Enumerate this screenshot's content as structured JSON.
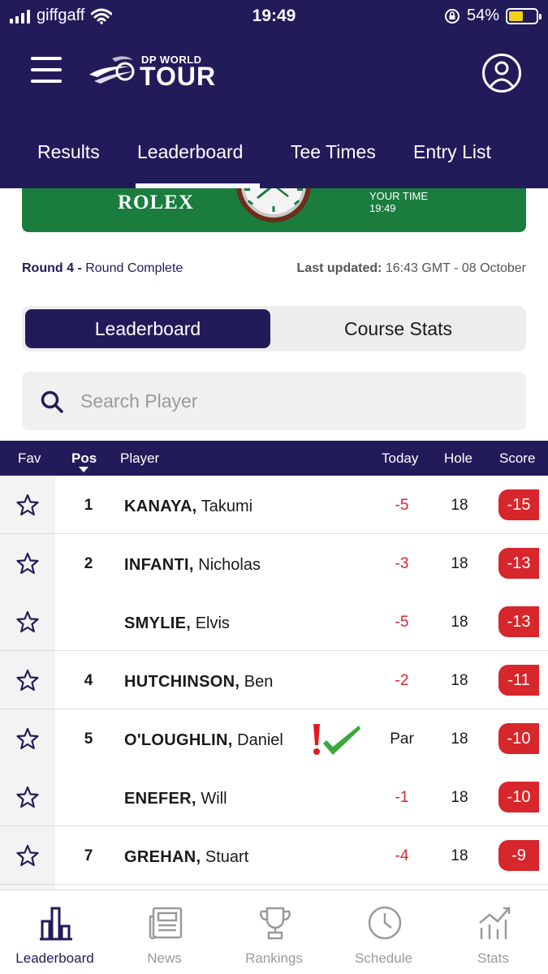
{
  "status_bar": {
    "carrier": "giffgaff",
    "time": "19:49",
    "battery": "54%"
  },
  "header": {
    "logo_small": "DP WORLD",
    "logo_big": "TOUR"
  },
  "nav_tabs": [
    {
      "label": "Results"
    },
    {
      "label": "Leaderboard",
      "active": true
    },
    {
      "label": "Tee Times"
    },
    {
      "label": "Entry List"
    }
  ],
  "banner": {
    "brand": "ROLEX",
    "your_time_label": "YOUR TIME",
    "your_time_value": "19:49"
  },
  "round_info": {
    "round": "Round 4",
    "separator": " - ",
    "status": "Round Complete",
    "updated_label": "Last updated:",
    "updated_value": " 16:43 GMT - 08 October"
  },
  "segmented": {
    "leaderboard": "Leaderboard",
    "course_stats": "Course Stats"
  },
  "search": {
    "placeholder": "Search Player"
  },
  "table": {
    "headers": {
      "fav": "Fav",
      "pos": "Pos",
      "player": "Player",
      "today": "Today",
      "hole": "Hole",
      "score": "Score"
    },
    "rows": [
      {
        "pos": "1",
        "surname": "KANAYA,",
        "firstname": "Takumi",
        "today": "-5",
        "hole": "18",
        "score": "-15"
      },
      {
        "pos": "2",
        "surname": "INFANTI,",
        "firstname": "Nicholas",
        "today": "-3",
        "hole": "18",
        "score": "-13"
      },
      {
        "pos": "",
        "surname": "SMYLIE,",
        "firstname": "Elvis",
        "today": "-5",
        "hole": "18",
        "score": "-13"
      },
      {
        "pos": "4",
        "surname": "HUTCHINSON,",
        "firstname": "Ben",
        "today": "-2",
        "hole": "18",
        "score": "-11"
      },
      {
        "pos": "5",
        "surname": "O'LOUGHLIN,",
        "firstname": "Daniel",
        "today": "Par",
        "hole": "18",
        "score": "-10"
      },
      {
        "pos": "",
        "surname": "ENEFER,",
        "firstname": "Will",
        "today": "-1",
        "hole": "18",
        "score": "-10"
      },
      {
        "pos": "7",
        "surname": "GREHAN,",
        "firstname": "Stuart",
        "today": "-4",
        "hole": "18",
        "score": "-9"
      }
    ]
  },
  "bottom_nav": [
    {
      "label": "Leaderboard",
      "icon": "leaderboard-icon",
      "active": true
    },
    {
      "label": "News",
      "icon": "news-icon"
    },
    {
      "label": "Rankings",
      "icon": "trophy-icon"
    },
    {
      "label": "Schedule",
      "icon": "clock-icon"
    },
    {
      "label": "Stats",
      "icon": "stats-icon"
    }
  ],
  "colors": {
    "brand_navy": "#221b5a",
    "score_red": "#d7262c",
    "rolex_green": "#1a7d3e"
  }
}
